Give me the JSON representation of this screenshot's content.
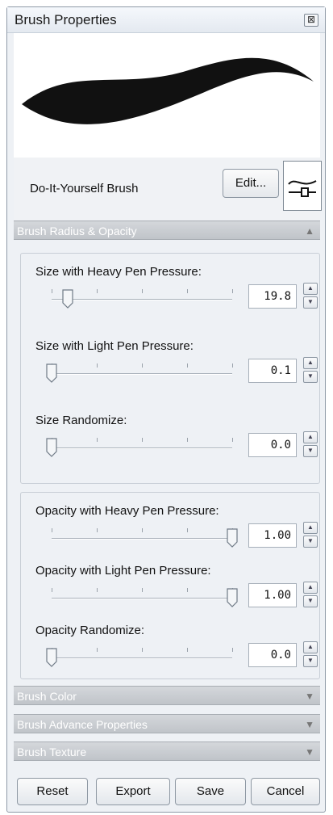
{
  "window": {
    "title": "Brush Properties",
    "close_glyph": "⊠"
  },
  "brush": {
    "name": "Do-It-Yourself Brush",
    "edit_label": "Edit...",
    "icon": "brush-stroke-icon"
  },
  "sections": {
    "radius_opacity": "Brush Radius & Opacity",
    "color": "Brush Color",
    "advanced": "Brush Advance Properties",
    "texture": "Brush Texture"
  },
  "size_controls": [
    {
      "label": "Size with Heavy Pen Pressure:",
      "value": "19.8",
      "slider_fraction": 0.09
    },
    {
      "label": "Size with Light Pen Pressure:",
      "value": "0.1",
      "slider_fraction": 0.0
    },
    {
      "label": "Size Randomize:",
      "value": "0.0",
      "slider_fraction": 0.0
    }
  ],
  "opacity_controls": [
    {
      "label": "Opacity with Heavy Pen Pressure:",
      "value": "1.00",
      "slider_fraction": 1.0
    },
    {
      "label": "Opacity with Light Pen Pressure:",
      "value": "1.00",
      "slider_fraction": 1.0
    },
    {
      "label": "Opacity Randomize:",
      "value": "0.0",
      "slider_fraction": 0.0
    }
  ],
  "footer": {
    "reset": "Reset",
    "export": "Export",
    "save": "Save",
    "cancel": "Cancel"
  },
  "colors": {
    "section_header": "#c6c9cd",
    "panel": "#eef1f5"
  }
}
